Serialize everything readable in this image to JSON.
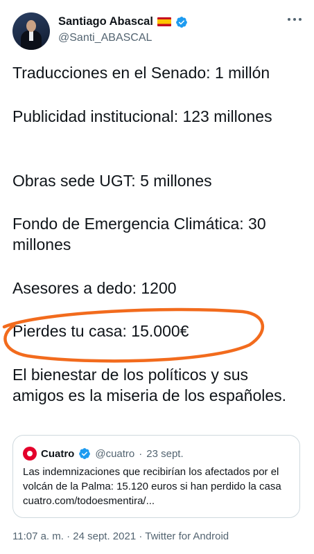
{
  "author": {
    "name": "Santiago Abascal",
    "handle": "@Santi_ABASCAL"
  },
  "tweet": {
    "lines": [
      "Traducciones en el Senado: 1 millón",
      "Publicidad institucional: 123 millones",
      "Obras sede UGT: 5 millones",
      "Fondo de Emergencia Climática: 30 millones",
      "Asesores a dedo: 1200",
      "Pierdes tu casa: 15.000€",
      "El bienestar de los políticos y sus amigos es la miseria de los españoles."
    ]
  },
  "quoted": {
    "name": "Cuatro",
    "handle": "@cuatro",
    "separator": "·",
    "date": "23 sept.",
    "text": "Las indemnizaciones que recibirían los afectados por el volcán de la Palma: 15.120 euros si han perdido la casa cuatro.com/todoesmentira/..."
  },
  "meta": "11:07 a. m. · 24 sept. 2021 · Twitter for Android",
  "colors": {
    "highlight_circle": "#f26b1d",
    "verified": "#1d9bf0",
    "secondary_text": "#536471"
  },
  "icons": {
    "verified": "verified-badge-icon",
    "flag": "spain-flag-icon",
    "more": "more-icon"
  }
}
